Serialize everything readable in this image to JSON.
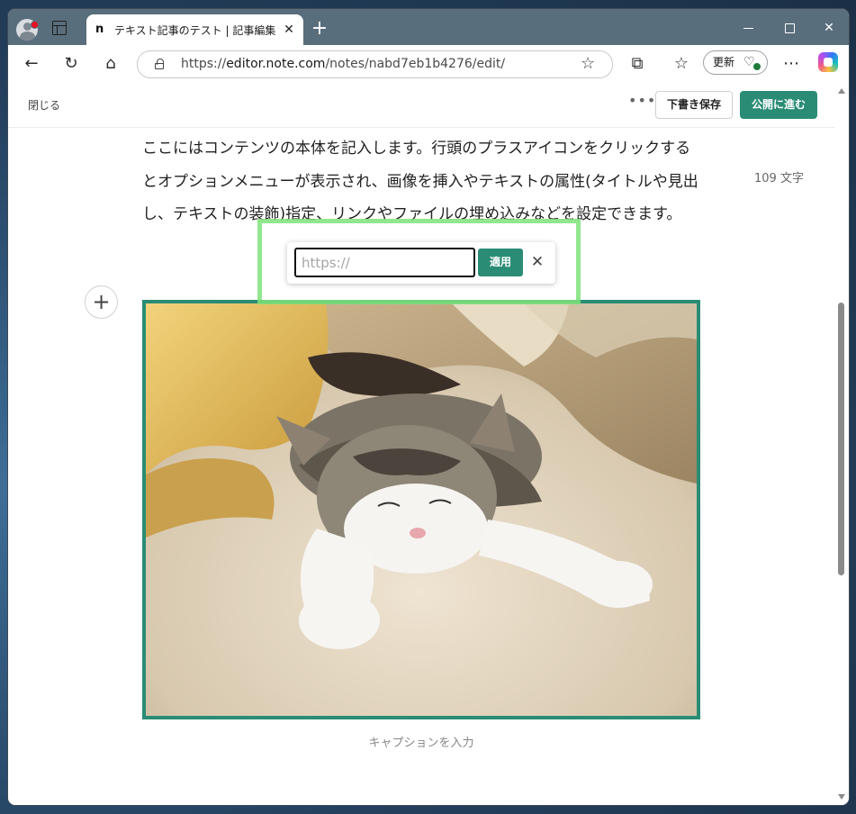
{
  "browser": {
    "tab_title": "テキスト記事のテスト | 記事編集 | note",
    "tab_favicon": "n",
    "url_scheme": "https://",
    "url_host": "editor.note.com",
    "url_path": "/notes/nabd7eb1b4276/edit/",
    "update_label": "更新",
    "icons": [
      "profile-icon",
      "tab-actions-icon",
      "close-icon",
      "new-tab-icon",
      "back-icon",
      "refresh-icon",
      "home-icon",
      "lock-icon",
      "favorite-star-icon",
      "extensions-icon",
      "favorites-icon",
      "health-icon",
      "more-icon",
      "copilot-icon",
      "minimize-icon",
      "maximize-icon",
      "close-window-icon"
    ]
  },
  "editor": {
    "close_label": "閉じる",
    "draft_save_label": "下書き保存",
    "publish_label": "公開に進む",
    "char_count": "109 文字",
    "body_text": "ここにはコンテンツの本体を記入します。行頭のプラスアイコンをクリックするとオプションメニューが表示され、画像を挿入やテキストの属性(タイトルや見出し、テキストの装飾)指定、リンクやファイルの埋め込みなどを設定できます。",
    "caption_placeholder": "キャプションを入力",
    "accent_color": "#2a8c74"
  },
  "link_popover": {
    "placeholder": "https://",
    "value": "",
    "apply_label": "適用"
  }
}
